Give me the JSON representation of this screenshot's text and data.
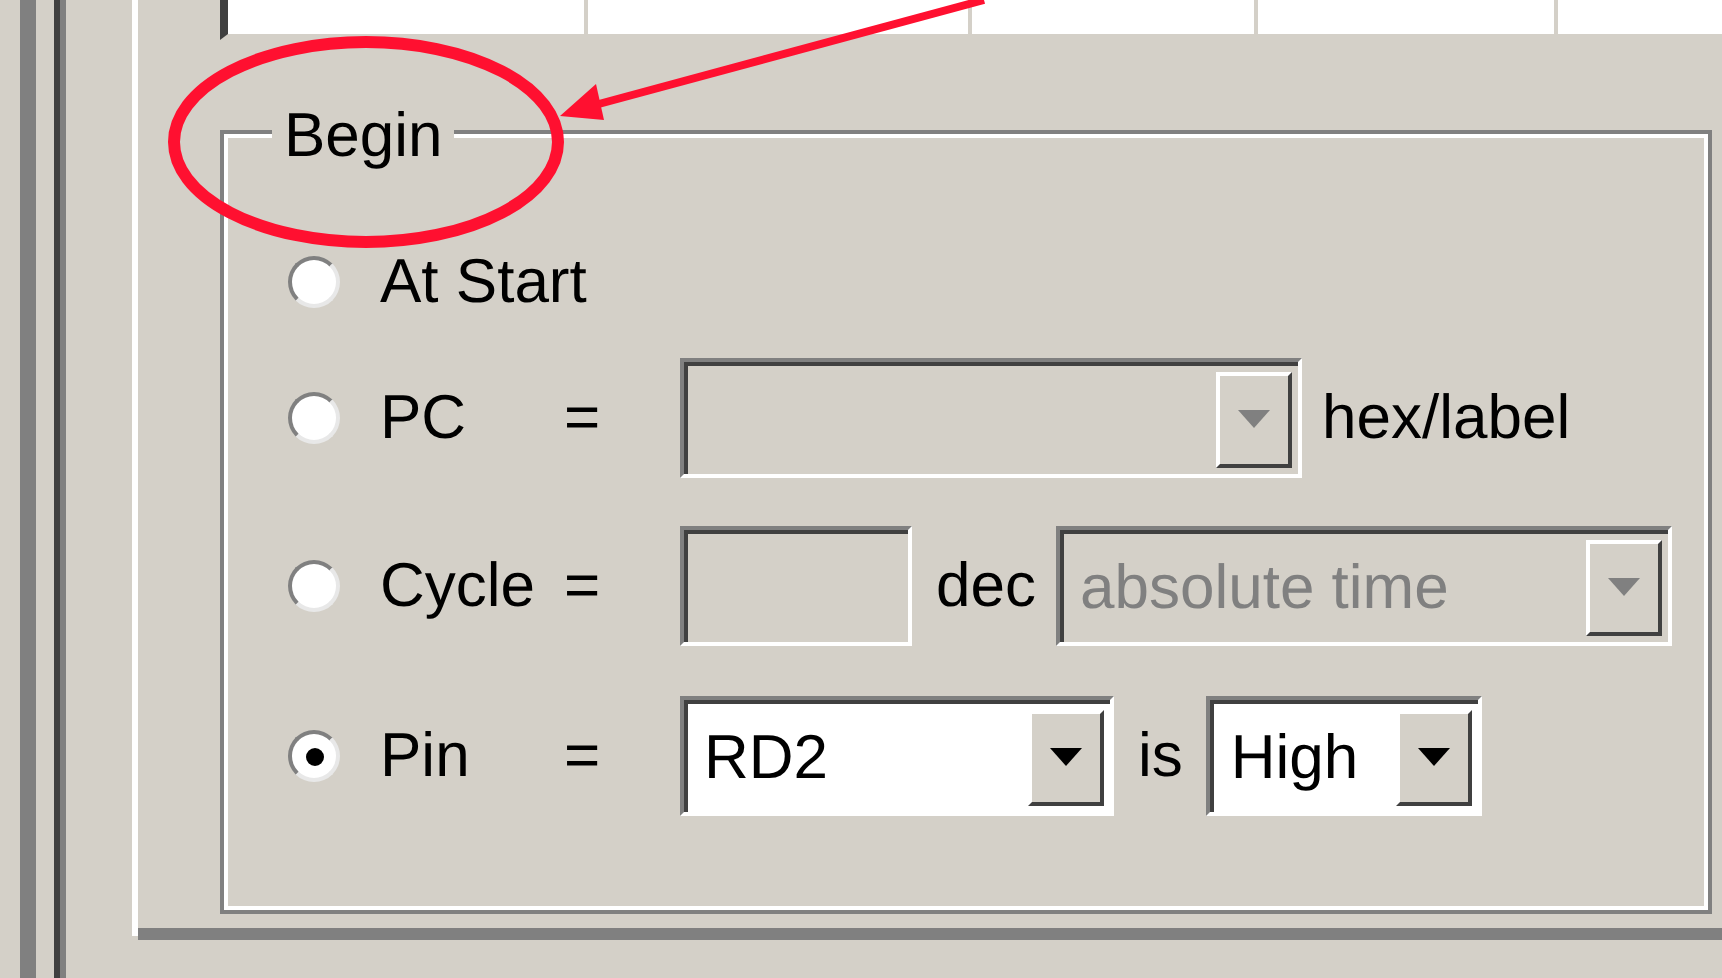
{
  "group": {
    "title": "Begin"
  },
  "options": [
    {
      "kind": "plain",
      "label": "At Start",
      "selected": false
    },
    {
      "kind": "pc",
      "label": "PC",
      "operator": "=",
      "combo": {
        "disabled": true
      },
      "suffix": "hex/label",
      "selected": false
    },
    {
      "kind": "cycle",
      "label": "Cycle",
      "operator": "=",
      "input": {
        "disabled": true
      },
      "unit": "dec",
      "combo": {
        "value": "absolute time",
        "disabled": true
      },
      "selected": false
    },
    {
      "kind": "pin",
      "label": "Pin",
      "operator": "=",
      "combo": {
        "value": "RD2",
        "disabled": false
      },
      "connector": "is",
      "combo2": {
        "value": "High",
        "disabled": false
      },
      "selected": true
    }
  ]
}
